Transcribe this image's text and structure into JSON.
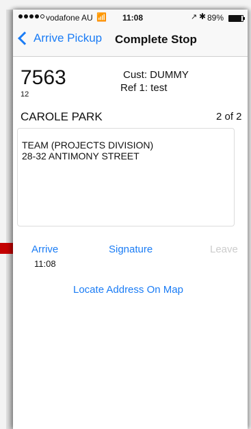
{
  "status_bar": {
    "carrier": "vodafone AU",
    "time": "11:08",
    "battery_percent": "89%",
    "battery_level": 0.89,
    "signal_bars_filled": 4,
    "signal_bars_total": 5
  },
  "nav": {
    "back_label": "Arrive Pickup",
    "title": "Complete Stop"
  },
  "stop": {
    "number": "7563",
    "sub_number": "12",
    "customer": "Cust:  DUMMY",
    "reference": "Ref 1:  test",
    "suburb": "CAROLE PARK",
    "position": "2 of 2",
    "address_line1": "TEAM (PROJECTS DIVISION)",
    "address_line2": "28-32 ANTIMONY STREET"
  },
  "actions": {
    "arrive_label": "Arrive",
    "arrive_time": "11:08",
    "signature_label": "Signature",
    "leave_label": "Leave",
    "locate_label": "Locate Address On Map"
  },
  "colors": {
    "accent": "#1a7cf5",
    "disabled": "#cccccc",
    "pointer": "#c40000"
  },
  "icons": {
    "wifi": "wifi-icon",
    "location": "location-arrow-icon",
    "bluetooth": "bluetooth-icon",
    "battery": "battery-icon",
    "back": "chevron-left-icon"
  }
}
